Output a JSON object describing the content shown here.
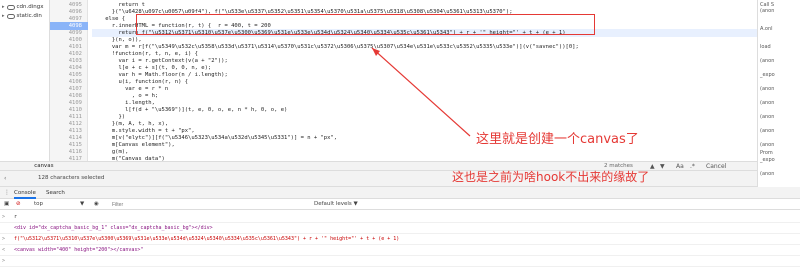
{
  "file_tree": {
    "items": [
      {
        "label": "cdn.dingx"
      },
      {
        "label": "static.din"
      }
    ]
  },
  "editor": {
    "lines": [
      {
        "no": "4095",
        "text": "        return t"
      },
      {
        "no": "4096",
        "text": "      }(\"\\u6428\\u097c\\u0057\\u09f4\"), f(\"\\u533e\\u5337\\u5352\\u5351\\u5354\\u5370\\u531a\\u5375\\u5318\\u5308\\u5304\\u5361\\u5313\\u5370\");"
      },
      {
        "no": "4097",
        "text": "    else {"
      },
      {
        "no": "4098",
        "text": "      r.innerHTML = function(r, t) {  r = 400, t = 200"
      },
      {
        "no": "4099",
        "text": "        return f(\"\\u5312\\u5371\\u5310\\u537e\\u5300\\u5369\\u531e\\u533e\\u534d\\u5324\\u5340\\u5334\\u535c\\u5361\\u5343\") + r + '\" height=\"' + t + (e + 1)"
      },
      {
        "no": "4100",
        "text": "      }(n, o)),"
      },
      {
        "no": "4101",
        "text": "      var m = r[f(\"\\u5349\\u532c\\u5358\\u533d\\u5371\\u5314\\u5370\\u531c\\u5372\\u5306\\u5375\\u5307\\u534e\\u531e\\u533c\\u5352\\u5335\\u533e\")](v(\"savnec\"))[0];"
      },
      {
        "no": "4102",
        "text": "      !function(r, t, n, e, i) {"
      },
      {
        "no": "4103",
        "text": "        var i = r.getContext(v(a + \"2\"));"
      },
      {
        "no": "4104",
        "text": "        l[e + c + s](t, 0, 0, n, e);"
      },
      {
        "no": "4105",
        "text": "        var h = Math.floor(n / i.length);"
      },
      {
        "no": "4106",
        "text": "        u(i, function(r, n) {"
      },
      {
        "no": "4107",
        "text": "          var e = r * n"
      },
      {
        "no": "4108",
        "text": "            , o = h;"
      },
      {
        "no": "4109",
        "text": "          i.length,"
      },
      {
        "no": "4110",
        "text": "          l[f(d + \"\\u5369\")](t, e, 0, o, e, n * h, 0, o, e)"
      },
      {
        "no": "4111",
        "text": "        })"
      },
      {
        "no": "4112",
        "text": "      }(m, A, t, h, x),"
      },
      {
        "no": "4113",
        "text": "      m.style.width = t + \"px\","
      },
      {
        "no": "4114",
        "text": "      m[v(\"elytc\")][f(\"\\u5346\\u5323\\u534a\\u532d\\u5345\\u5331\")] = n + \"px\","
      },
      {
        "no": "4115",
        "text": "      m[Canvas element\"),"
      },
      {
        "no": "4116",
        "text": "      g(m),"
      },
      {
        "no": "4117",
        "text": "      m(\"Canvas data\")"
      },
      {
        "no": "4118",
        "text": ""
      }
    ]
  },
  "search": {
    "value": "canvas",
    "match_count": "2 matches",
    "up": "▲",
    "down": "▼",
    "case_label": "Aa",
    "regex_label": ".*",
    "cancel_label": "Cancel"
  },
  "status": {
    "text": "128 characters selected"
  },
  "drawer": {
    "tabs": [
      {
        "label": "Console"
      },
      {
        "label": "Search"
      }
    ]
  },
  "console_toolbar": {
    "context": "top",
    "filter_placeholder": "Filter",
    "levels": "Default levels ▼"
  },
  "console": {
    "lines": [
      {
        "prefix": ">",
        "text": "r"
      },
      {
        "prefix": "",
        "text": "<div id=\"dx_captcha_basic_bg_1\" class=\"dx_captcha_basic_bg\"></div>"
      },
      {
        "prefix": ">",
        "text": "f(\"\\u5312\\u5371\\u5310\\u537e\\u5300\\u5369\\u531e\\u533e\\u534d\\u5324\\u5340\\u5334\\u535c\\u5361\\u5343\") + r + '\" height=\"' + t + (e + 1)"
      },
      {
        "prefix": "<",
        "text": "<canvas width=\"400\" height=\"200\"></canvas>\""
      },
      {
        "prefix": ">",
        "text": ""
      }
    ]
  },
  "scope": {
    "items": [
      "Call S",
      "(anon",
      "A.onl",
      "load",
      "(anon",
      "_expo",
      "(anon",
      "(anon",
      "(anon",
      "(anon",
      "(anon",
      "Prom",
      "_expo",
      "(anon"
    ]
  },
  "annotations": {
    "note1": "这里就是创建一个canvas了",
    "note2": "这也是之前为啥hook不出来的缘故了"
  },
  "colors": {
    "annotation_red": "#e53935",
    "highlight_blue": "#8ab4f8"
  }
}
